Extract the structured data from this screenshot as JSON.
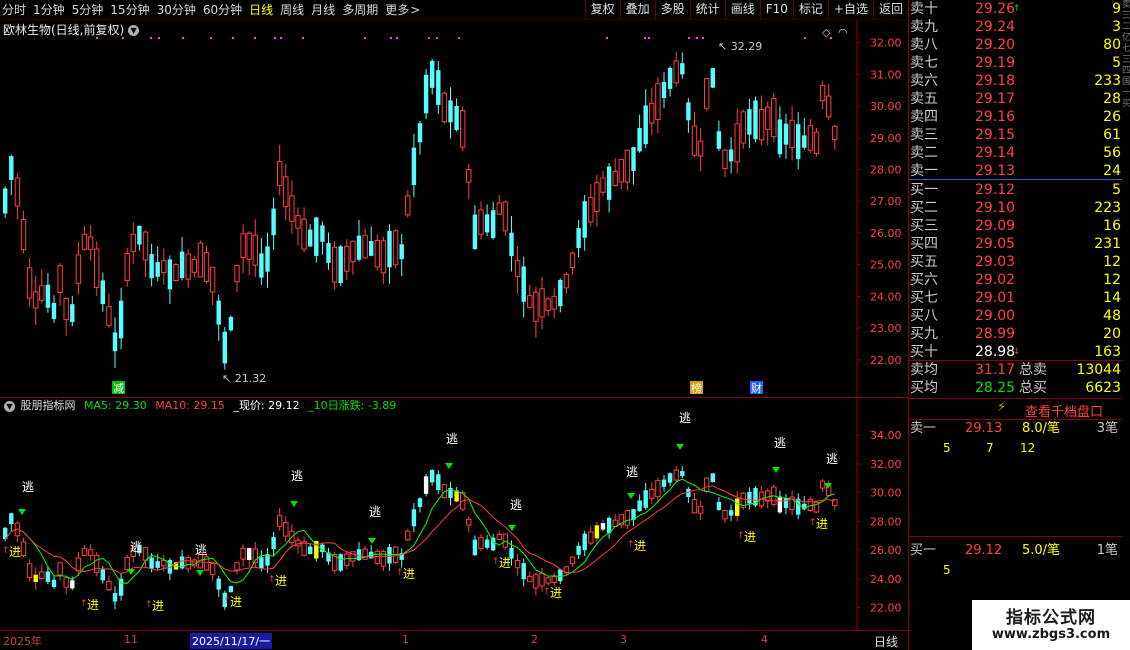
{
  "toolbar": {
    "periods": [
      "分时",
      "1分钟",
      "5分钟",
      "15分钟",
      "30分钟",
      "60分钟",
      "日线",
      "周线",
      "月线",
      "多周期",
      "更多"
    ],
    "active_period": "日线",
    "more_chevron": "chevron-right-icon",
    "actions": [
      "复权",
      "叠加",
      "多股",
      "统计",
      "画线",
      "F10",
      "标记",
      "+自选",
      "返回"
    ]
  },
  "main": {
    "title": "欧林生物(日线,前复权)",
    "title_icon": "chevron-down-icon",
    "y_ticks": [
      "32.00",
      "31.00",
      "30.00",
      "29.00",
      "28.00",
      "27.00",
      "26.00",
      "25.00",
      "24.00",
      "23.00",
      "22.00"
    ],
    "high_label": "32.29",
    "low_label": "21.32",
    "markers": [
      "减",
      "榜",
      "财"
    ],
    "top_right_icons": [
      "diamond-icon",
      "scroll-up-icon"
    ]
  },
  "indicator": {
    "name": "股朋指标网",
    "menu_icon": "chevron-down-icon",
    "ma5": "MA5: 29.30",
    "ma10": "MA10: 29.15",
    "price": "_现价: 29.12",
    "change10": "_10日涨跌: -3.89",
    "y_ticks": [
      "34.00",
      "32.00",
      "30.00",
      "28.00",
      "26.00",
      "24.00",
      "22.00"
    ],
    "signal_in": "进",
    "signal_out": "逃"
  },
  "time_axis": {
    "labels": [
      "2025年",
      "11",
      "2025/11/17/一",
      "1",
      "2",
      "3",
      "4"
    ],
    "period": "日线"
  },
  "order_book": {
    "asks": [
      {
        "label": "卖十",
        "price": "29.26",
        "vol": "9",
        "flag": "up-arrow-icon"
      },
      {
        "label": "卖九",
        "price": "29.24",
        "vol": "3"
      },
      {
        "label": "卖八",
        "price": "29.20",
        "vol": "80"
      },
      {
        "label": "卖七",
        "price": "29.19",
        "vol": "5"
      },
      {
        "label": "卖六",
        "price": "29.18",
        "vol": "233"
      },
      {
        "label": "卖五",
        "price": "29.17",
        "vol": "28"
      },
      {
        "label": "卖四",
        "price": "29.16",
        "vol": "26"
      },
      {
        "label": "卖三",
        "price": "29.15",
        "vol": "61"
      },
      {
        "label": "卖二",
        "price": "29.14",
        "vol": "56"
      },
      {
        "label": "卖一",
        "price": "29.13",
        "vol": "24"
      }
    ],
    "bids": [
      {
        "label": "买一",
        "price": "29.12",
        "vol": "5"
      },
      {
        "label": "买二",
        "price": "29.10",
        "vol": "223"
      },
      {
        "label": "买三",
        "price": "29.09",
        "vol": "16"
      },
      {
        "label": "买四",
        "price": "29.05",
        "vol": "231"
      },
      {
        "label": "买五",
        "price": "29.03",
        "vol": "12"
      },
      {
        "label": "买六",
        "price": "29.02",
        "vol": "12"
      },
      {
        "label": "买七",
        "price": "29.01",
        "vol": "14"
      },
      {
        "label": "买八",
        "price": "29.00",
        "vol": "48"
      },
      {
        "label": "买九",
        "price": "28.99",
        "vol": "20"
      },
      {
        "label": "买十",
        "price": "28.98",
        "vol": "163",
        "flag": "down-arrow-icon"
      }
    ],
    "avg_sell_label": "卖均",
    "avg_sell_price": "31.17",
    "total_sell_label": "总卖",
    "total_sell": "13044",
    "avg_buy_label": "买均",
    "avg_buy_price": "28.25",
    "total_buy_label": "总买",
    "total_buy": "6623",
    "ten_level_button": "查看千档盘口",
    "ten_level_icon": "lightning-icon",
    "queue_sell": {
      "label": "卖一",
      "price": "29.13",
      "per": "8.0/笔",
      "count": "3笔",
      "orders": [
        "5",
        "7",
        "12"
      ]
    },
    "queue_buy": {
      "label": "买一",
      "price": "29.12",
      "per": "5.0/笔",
      "count": "1笔",
      "orders": [
        "5"
      ]
    }
  },
  "watermark": {
    "title": "指标公式网",
    "url": "www.zbgs3.com"
  },
  "colors": {
    "up": "#ff3c3c",
    "down": "#54ffff",
    "ma5": "#00ff00",
    "ma10": "#ff3c3c",
    "price_text": "#ffffff",
    "change_text": "#00ff00"
  }
}
